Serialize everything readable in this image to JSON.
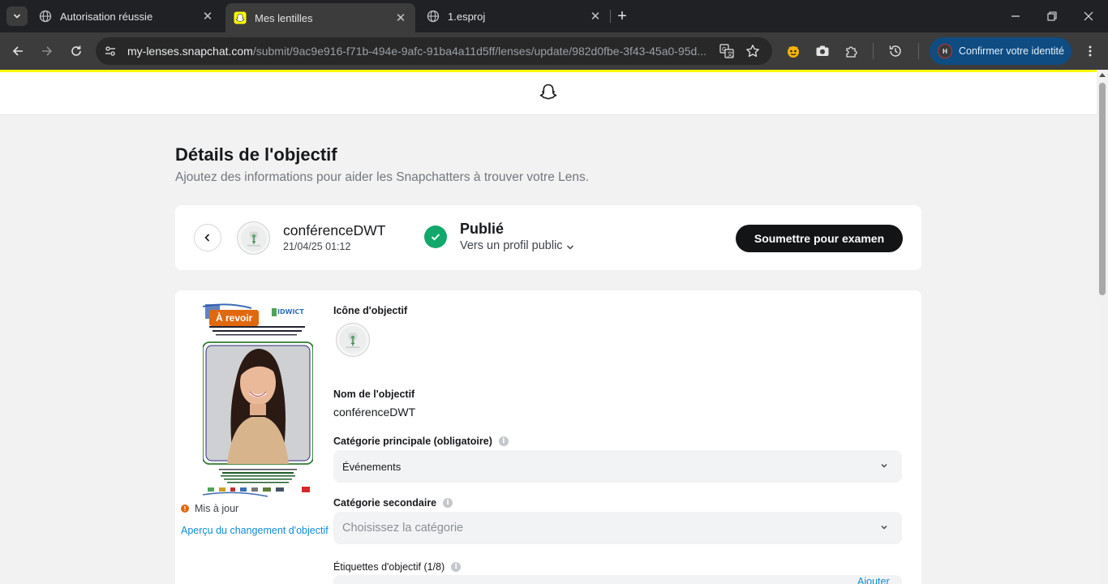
{
  "browser": {
    "tabs": [
      {
        "title": "Autorisation réussie",
        "favicon": "globe-icon",
        "active": false
      },
      {
        "title": "Mes lentilles",
        "favicon": "snapchat-icon",
        "active": true
      },
      {
        "title": "1.esproj",
        "favicon": "globe-icon",
        "active": false
      }
    ],
    "url_host": "my-lenses.snapchat.com",
    "url_path": "/submit/9ac9e916-f71b-494e-9afc-91ba4a11d5ff/lenses/update/982d0fbe-3f43-45a0-95d...",
    "profile_button": "Confirmer votre identité",
    "profile_initial": "H"
  },
  "page": {
    "title": "Détails de l'objectif",
    "subtitle": "Ajoutez des informations pour aider les Snapchatters à trouver votre Lens."
  },
  "lens": {
    "name": "conférenceDWT",
    "date": "21/04/25 01:12",
    "status": "Publié",
    "visibility": "Vers un profil public",
    "submit_label": "Soumettre pour examen"
  },
  "preview": {
    "badge": "À revoir",
    "update_status": "Mis à jour",
    "change_link": "Aperçu du changement d'objectif",
    "poster_title": "IDWICT"
  },
  "form": {
    "icon_label": "Icône d'objectif",
    "name_label": "Nom de l'objectif",
    "name_value": "conférenceDWT",
    "primary_category_label": "Catégorie principale (obligatoire)",
    "primary_category_value": "Événements",
    "secondary_category_label": "Catégorie secondaire",
    "secondary_category_placeholder": "Choisissez la catégorie",
    "tags_label": "Étiquettes d'objectif (1/8)",
    "tags_add": "Ajouter"
  },
  "colors": {
    "accent_yellow": "#fffc00",
    "published_green": "#12a86b",
    "review_orange": "#e0680f",
    "link_blue": "#0f8cd6"
  }
}
